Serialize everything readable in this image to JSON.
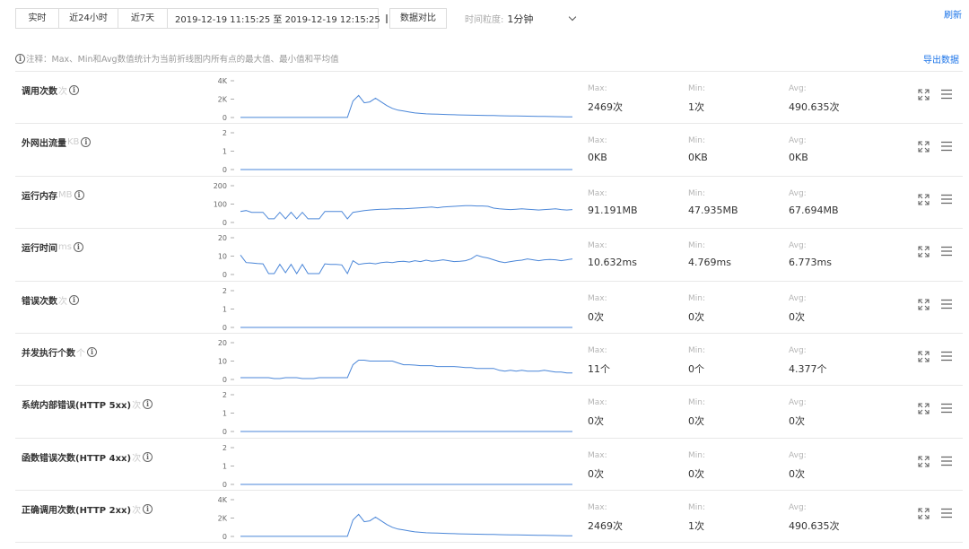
{
  "toolbar": {
    "ranges": [
      "实时",
      "近24小时",
      "近7天"
    ],
    "range_widths": [
      48,
      66,
      54
    ],
    "date_range": "2019-12-19 11:15:25 至 2019-12-19 12:15:25",
    "compare_label": "数据对比",
    "granularity_label": "时间粒度:",
    "granularity_value": "1分钟",
    "refresh_label": "刷新"
  },
  "note": "注释：Max、Min和Avg数值统计为当前折线图内所有点的最大值、最小值和平均值",
  "export_label": "导出数据",
  "stat_labels": {
    "max": "Max:",
    "min": "Min:",
    "avg": "Avg:"
  },
  "colors": {
    "line": "#4a86d8",
    "link": "#1a73e8"
  },
  "icons": [
    "info-icon",
    "calendar-icon",
    "chevron-down-icon",
    "expand-icon",
    "menu-icon"
  ],
  "chart_data": [
    {
      "type": "line",
      "title": "调用次数",
      "unit": "次",
      "yticks": [
        "4K",
        "2K",
        "0"
      ],
      "ylim": [
        0,
        4000
      ],
      "x": [
        0,
        1,
        2,
        3,
        4,
        5,
        6,
        7,
        8,
        9,
        10,
        11,
        12,
        13,
        14,
        15,
        16,
        17,
        18,
        19,
        20,
        21,
        22,
        23,
        24,
        25,
        26,
        27,
        28,
        29,
        30,
        31,
        32,
        33,
        34,
        35,
        36,
        37,
        38,
        39,
        40,
        41,
        42,
        43,
        44,
        45,
        46,
        47,
        48,
        49,
        50,
        51,
        52,
        53,
        54,
        55,
        56,
        57,
        58,
        59
      ],
      "values": [
        10,
        10,
        10,
        10,
        10,
        10,
        10,
        10,
        10,
        10,
        10,
        10,
        10,
        10,
        10,
        10,
        10,
        10,
        10,
        10,
        10,
        10,
        10,
        10,
        10,
        10,
        10,
        10,
        10,
        10,
        10,
        10,
        10,
        10,
        10,
        10,
        10,
        10,
        10,
        10,
        10,
        10,
        10,
        10,
        10,
        10,
        10,
        10,
        10,
        10,
        10,
        10,
        10,
        10,
        10,
        10,
        10,
        10,
        10,
        10
      ],
      "max": "2469次",
      "min": "1次",
      "avg": "490.635次"
    },
    {
      "type": "line",
      "title": "外网出流量",
      "unit": "KB",
      "yticks": [
        "2",
        "1",
        "0"
      ],
      "ylim": [
        0,
        2
      ],
      "values": [
        0,
        0,
        0,
        0,
        0,
        0,
        0,
        0,
        0,
        0,
        0,
        0,
        0,
        0,
        0,
        0,
        0,
        0,
        0,
        0,
        0,
        0,
        0,
        0,
        0,
        0,
        0,
        0,
        0,
        0,
        0,
        0,
        0,
        0,
        0,
        0,
        0,
        0,
        0,
        0,
        0,
        0,
        0,
        0,
        0,
        0,
        0,
        0,
        0,
        0,
        0,
        0,
        0,
        0,
        0,
        0,
        0,
        0,
        0,
        0
      ],
      "max": "0KB",
      "min": "0KB",
      "avg": "0KB"
    },
    {
      "type": "line",
      "title": "运行内存",
      "unit": "MB",
      "yticks": [
        "200",
        "100",
        "0"
      ],
      "ylim": [
        0,
        200
      ],
      "values": [
        60,
        65,
        55,
        55,
        55,
        20,
        20,
        55,
        20,
        55,
        20,
        55,
        20,
        20,
        20,
        60,
        60,
        60,
        60,
        20,
        55,
        60,
        65,
        68,
        70,
        72,
        72,
        74,
        75,
        74,
        76,
        78,
        80,
        82,
        84,
        80,
        84,
        86,
        88,
        90,
        91,
        91,
        90,
        90,
        88,
        78,
        74,
        72,
        70,
        72,
        74,
        72,
        70,
        68,
        70,
        72,
        74,
        70,
        68,
        70
      ],
      "max": "91.191MB",
      "min": "47.935MB",
      "avg": "67.694MB"
    },
    {
      "type": "line",
      "title": "运行时间",
      "unit": "ms",
      "yticks": [
        "20",
        "10",
        "0"
      ],
      "ylim": [
        0,
        20
      ],
      "values": [
        10.6,
        6.5,
        6.3,
        6.0,
        5.8,
        0.5,
        0.5,
        5.5,
        1.0,
        5.5,
        0.5,
        5.5,
        0.5,
        0.5,
        0.5,
        5.8,
        5.5,
        5.5,
        5.2,
        0.5,
        7.5,
        5.5,
        6.0,
        6.2,
        5.8,
        6.5,
        6.8,
        6.5,
        7.0,
        7.2,
        6.8,
        7.5,
        7.0,
        7.8,
        7.2,
        7.5,
        8.0,
        7.5,
        7.0,
        7.2,
        7.5,
        8.5,
        10.5,
        9.5,
        9.0,
        8.0,
        7.0,
        6.5,
        7.0,
        7.5,
        7.8,
        8.5,
        8.0,
        7.5,
        8.0,
        8.2,
        8.0,
        7.5,
        8.0,
        8.5
      ],
      "max": "10.632ms",
      "min": "4.769ms",
      "avg": "6.773ms"
    },
    {
      "type": "line",
      "title": "错误次数",
      "unit": "次",
      "yticks": [
        "2",
        "1",
        "0"
      ],
      "ylim": [
        0,
        2
      ],
      "values": [
        0,
        0,
        0,
        0,
        0,
        0,
        0,
        0,
        0,
        0,
        0,
        0,
        0,
        0,
        0,
        0,
        0,
        0,
        0,
        0,
        0,
        0,
        0,
        0,
        0,
        0,
        0,
        0,
        0,
        0,
        0,
        0,
        0,
        0,
        0,
        0,
        0,
        0,
        0,
        0,
        0,
        0,
        0,
        0,
        0,
        0,
        0,
        0,
        0,
        0,
        0,
        0,
        0,
        0,
        0,
        0,
        0,
        0,
        0,
        0
      ],
      "max": "0次",
      "min": "0次",
      "avg": "0次"
    },
    {
      "type": "line",
      "title": "并发执行个数",
      "unit": "个",
      "yticks": [
        "20",
        "10",
        "0"
      ],
      "ylim": [
        0,
        20
      ],
      "values": [
        1,
        1,
        1,
        1,
        1,
        1,
        0.5,
        0.5,
        1,
        1,
        1,
        0.5,
        0.5,
        0.5,
        1,
        1,
        1,
        1,
        1,
        1,
        8,
        10.5,
        10.5,
        10,
        10,
        10,
        10,
        10,
        9,
        8,
        8,
        7.8,
        7.5,
        7.5,
        7.5,
        7,
        7,
        7,
        7,
        6.8,
        6.5,
        6.5,
        6,
        6,
        6,
        6,
        5,
        4.5,
        5,
        4.5,
        5,
        4.5,
        4.5,
        4.5,
        5,
        4.5,
        4,
        4,
        3.5,
        3.5
      ],
      "max": "11个",
      "min": "0个",
      "avg": "4.377个"
    },
    {
      "type": "line",
      "title": "系统内部错误(HTTP 5xx)",
      "unit": "次",
      "yticks": [
        "2",
        "1",
        "0"
      ],
      "ylim": [
        0,
        2
      ],
      "values": [
        0,
        0,
        0,
        0,
        0,
        0,
        0,
        0,
        0,
        0,
        0,
        0,
        0,
        0,
        0,
        0,
        0,
        0,
        0,
        0,
        0,
        0,
        0,
        0,
        0,
        0,
        0,
        0,
        0,
        0,
        0,
        0,
        0,
        0,
        0,
        0,
        0,
        0,
        0,
        0,
        0,
        0,
        0,
        0,
        0,
        0,
        0,
        0,
        0,
        0,
        0,
        0,
        0,
        0,
        0,
        0,
        0,
        0,
        0,
        0
      ],
      "max": "0次",
      "min": "0次",
      "avg": "0次"
    },
    {
      "type": "line",
      "title": "函数错误次数(HTTP 4xx)",
      "unit": "次",
      "yticks": [
        "2",
        "1",
        "0"
      ],
      "ylim": [
        0,
        2
      ],
      "values": [
        0,
        0,
        0,
        0,
        0,
        0,
        0,
        0,
        0,
        0,
        0,
        0,
        0,
        0,
        0,
        0,
        0,
        0,
        0,
        0,
        0,
        0,
        0,
        0,
        0,
        0,
        0,
        0,
        0,
        0,
        0,
        0,
        0,
        0,
        0,
        0,
        0,
        0,
        0,
        0,
        0,
        0,
        0,
        0,
        0,
        0,
        0,
        0,
        0,
        0,
        0,
        0,
        0,
        0,
        0,
        0,
        0,
        0,
        0,
        0
      ],
      "max": "0次",
      "min": "0次",
      "avg": "0次"
    },
    {
      "type": "line",
      "title": "正确调用次数(HTTP 2xx)",
      "unit": "次",
      "yticks": [
        "4K",
        "2K",
        "0"
      ],
      "ylim": [
        0,
        4000
      ],
      "values": [
        10,
        10,
        10,
        10,
        10,
        10,
        10,
        10,
        10,
        10,
        10,
        10,
        10,
        10,
        10,
        10,
        10,
        10,
        10,
        10,
        1800,
        2400,
        1600,
        1700,
        2100,
        1700,
        1300,
        1000,
        800,
        700,
        600,
        500,
        450,
        400,
        380,
        360,
        340,
        320,
        300,
        280,
        260,
        250,
        240,
        230,
        220,
        210,
        200,
        190,
        180,
        170,
        160,
        150,
        140,
        130,
        120,
        110,
        100,
        90,
        80,
        70
      ],
      "max": "2469次",
      "min": "1次",
      "avg": "490.635次"
    }
  ]
}
